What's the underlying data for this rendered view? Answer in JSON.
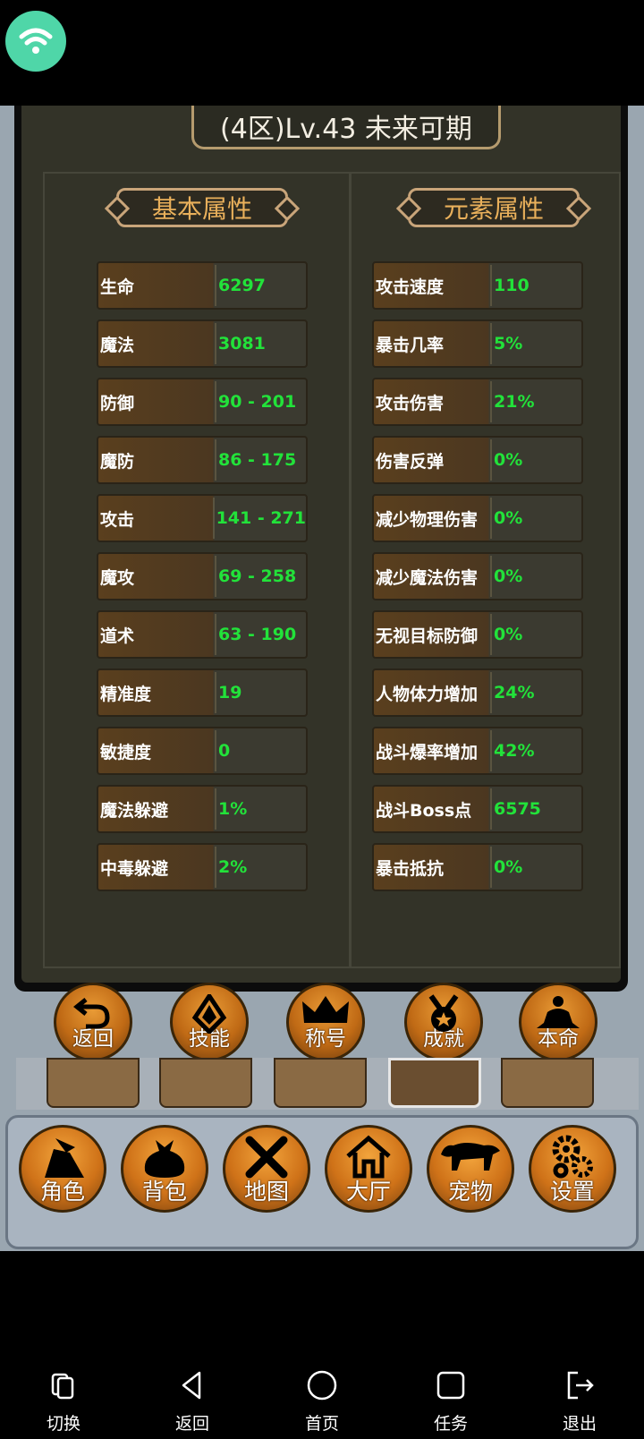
{
  "status": {
    "wifi_icon": "wifi-icon",
    "wifi_color": "#4fd6a8"
  },
  "title": "(4区)Lv.43 未来可期",
  "sections": {
    "basic": "基本属性",
    "element": "元素属性"
  },
  "basic_stats": [
    {
      "label": "生命",
      "value": "6297"
    },
    {
      "label": "魔法",
      "value": "3081"
    },
    {
      "label": "防御",
      "value": "90 - 201"
    },
    {
      "label": "魔防",
      "value": "86 - 175"
    },
    {
      "label": "攻击",
      "value": "141 - 271"
    },
    {
      "label": "魔攻",
      "value": "69 - 258"
    },
    {
      "label": "道术",
      "value": "63 - 190"
    },
    {
      "label": "精准度",
      "value": "19"
    },
    {
      "label": "敏捷度",
      "value": "0"
    },
    {
      "label": "魔法躲避",
      "value": "1%"
    },
    {
      "label": "中毒躲避",
      "value": "2%"
    }
  ],
  "element_stats": [
    {
      "label": "攻击速度",
      "value": "110"
    },
    {
      "label": "暴击几率",
      "value": "5%"
    },
    {
      "label": "攻击伤害",
      "value": "21%"
    },
    {
      "label": "伤害反弹",
      "value": "0%"
    },
    {
      "label": "减少物理伤害",
      "value": "0%"
    },
    {
      "label": "减少魔法伤害",
      "value": "0%"
    },
    {
      "label": "无视目标防御",
      "value": "0%"
    },
    {
      "label": "人物体力增加",
      "value": "24%"
    },
    {
      "label": "战斗爆率增加",
      "value": "42%"
    },
    {
      "label": "战斗Boss点",
      "value": "6575"
    },
    {
      "label": "暴击抵抗",
      "value": "0%"
    }
  ],
  "action_buttons": [
    "返回",
    "技能",
    "称号",
    "成就",
    "本命"
  ],
  "main_nav": [
    "角色",
    "背包",
    "地图",
    "大厅",
    "宠物",
    "设置"
  ],
  "system_nav": [
    "切换",
    "返回",
    "首页",
    "任务",
    "退出"
  ],
  "colors": {
    "value_green": "#22e23a",
    "header_gold": "#e9b05b",
    "button_orange": "#cf7218"
  }
}
